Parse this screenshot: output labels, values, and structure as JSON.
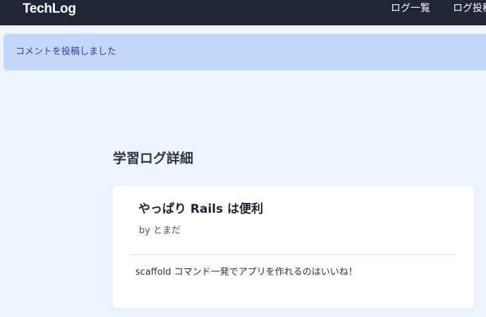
{
  "navbar": {
    "brand": "TechLog",
    "links": [
      {
        "label": "ログ一覧"
      },
      {
        "label": "ログ投稿"
      }
    ]
  },
  "flash": {
    "message": "コメントを投稿しました"
  },
  "page": {
    "title": "学習ログ詳細"
  },
  "post": {
    "title": "やっぱり Rails は便利",
    "author": "by とまだ",
    "body": "scaffold コマンド一発でアプリを作れるのはいいね！"
  },
  "colors": {
    "navbar_bg": "#1f2638",
    "page_bg": "#eef5ff",
    "flash_bg": "#c3d9fb",
    "flash_text": "#2f3fa5"
  }
}
